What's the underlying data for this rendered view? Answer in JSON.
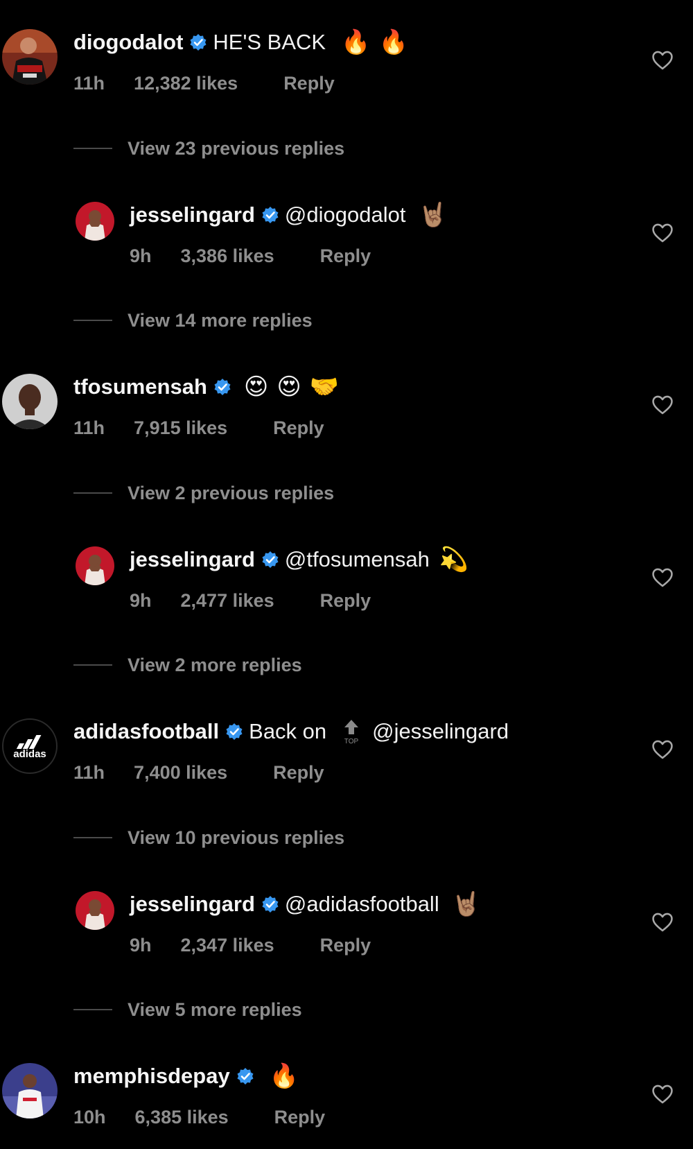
{
  "colors": {
    "background": "#000000",
    "primary_text": "#f2f2f2",
    "secondary_text": "#8e8e8e",
    "verified_blue": "#3897f0"
  },
  "threads": [
    {
      "comment": {
        "username": "diogodalot",
        "verified": true,
        "text": "HE'S BACK",
        "emojis": [
          "🔥",
          "🔥"
        ],
        "time": "11h",
        "likes": "12,382 likes",
        "reply_label": "Reply"
      },
      "view_previous": "View 23 previous replies",
      "reply": {
        "username": "jesselingard",
        "verified": true,
        "mention": "@diogodalot",
        "emoji": "🤘🏽",
        "time": "9h",
        "likes": "3,386 likes",
        "reply_label": "Reply"
      },
      "view_more": "View 14 more replies"
    },
    {
      "comment": {
        "username": "tfosumensah",
        "verified": true,
        "text": "",
        "emojis": [
          "😍",
          "😍",
          "🤝"
        ],
        "time": "11h",
        "likes": "7,915 likes",
        "reply_label": "Reply"
      },
      "view_previous": "View 2 previous replies",
      "reply": {
        "username": "jesselingard",
        "verified": true,
        "mention": "@tfosumensah",
        "emoji": "💫",
        "time": "9h",
        "likes": "2,477 likes",
        "reply_label": "Reply"
      },
      "view_more": "View 2 more replies"
    },
    {
      "comment": {
        "username": "adidasfootball",
        "verified": true,
        "text": "Back on",
        "emoji_icon": "top-arrow-icon",
        "top_label": "TOP",
        "mention": "@jesselingard",
        "time": "11h",
        "likes": "7,400 likes",
        "reply_label": "Reply"
      },
      "view_previous": "View 10 previous replies",
      "reply": {
        "username": "jesselingard",
        "verified": true,
        "mention": "@adidasfootball",
        "emoji": "🤘🏽",
        "time": "9h",
        "likes": "2,347 likes",
        "reply_label": "Reply"
      },
      "view_more": "View 5 more replies"
    },
    {
      "comment": {
        "username": "memphisdepay",
        "verified": true,
        "text": "",
        "emojis": [
          "🔥"
        ],
        "time": "10h",
        "likes": "6,385 likes",
        "reply_label": "Reply"
      }
    }
  ],
  "icons": {
    "like": "heart-outline-icon",
    "verified": "verified-badge-icon"
  },
  "adidas_logo_text": "adidas"
}
